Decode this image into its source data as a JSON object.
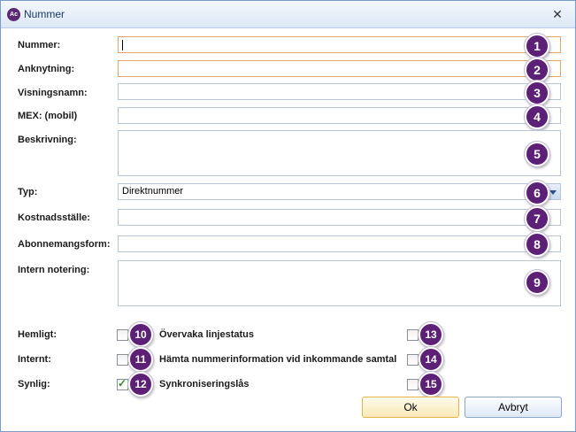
{
  "window": {
    "title": "Nummer",
    "app_icon_text": "Ac"
  },
  "form": {
    "fields": [
      {
        "label": "Nummer:",
        "badge": "1"
      },
      {
        "label": "Anknytning:",
        "badge": "2"
      },
      {
        "label": "Visningsnamn:",
        "badge": "3"
      },
      {
        "label": "MEX: (mobil)",
        "badge": "4"
      },
      {
        "label": "Beskrivning:",
        "badge": "5"
      },
      {
        "label": "Typ:",
        "badge": "6",
        "value": "Direktnummer"
      },
      {
        "label": "Kostnadsställe:",
        "badge": "7"
      },
      {
        "label": "Abonnemangsform:",
        "badge": "8"
      },
      {
        "label": "Intern notering:",
        "badge": "9"
      }
    ],
    "checkboxes_left": [
      {
        "label": "Hemligt:",
        "badge": "10",
        "checked": false
      },
      {
        "label": "Internt:",
        "badge": "11",
        "checked": false
      },
      {
        "label": "Synlig:",
        "badge": "12",
        "checked": true
      }
    ],
    "checkboxes_right": [
      {
        "label": "Övervaka linjestatus",
        "badge": "13",
        "checked": false
      },
      {
        "label": "Hämta nummerinformation vid inkommande samtal",
        "badge": "14",
        "checked": false
      },
      {
        "label": "Synkroniseringslås",
        "badge": "15",
        "checked": false
      }
    ]
  },
  "buttons": {
    "ok": "Ok",
    "cancel": "Avbryt"
  },
  "colors": {
    "badge": "#5c2177",
    "required_border": "#e3a36a",
    "default_button": "#fbe9b7"
  }
}
